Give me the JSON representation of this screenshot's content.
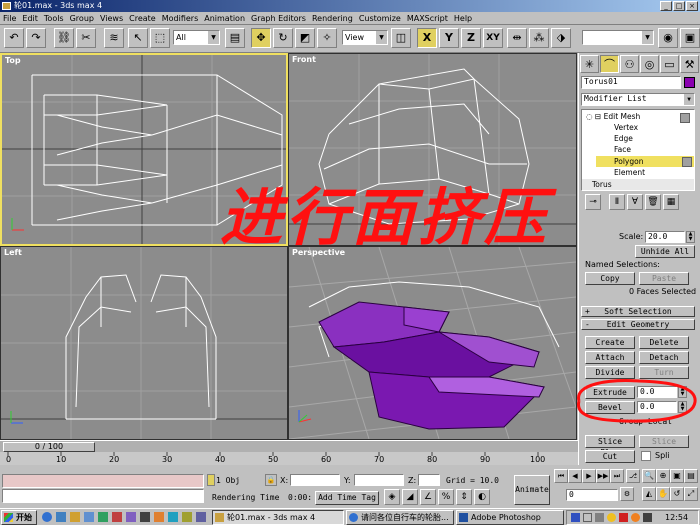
{
  "window": {
    "title": "轮01.max - 3ds max 4"
  },
  "menu": [
    "File",
    "Edit",
    "Tools",
    "Group",
    "Views",
    "Create",
    "Modifiers",
    "Animation",
    "Graph Editors",
    "Rendering",
    "Customize",
    "MAXScript",
    "Help"
  ],
  "toolbar": {
    "selection_filter": "All",
    "ref_coord": "View",
    "axis_x": "X",
    "axis_y": "Y",
    "axis_z": "Z",
    "axis_xy": "XY"
  },
  "viewports": {
    "top": "Top",
    "front": "Front",
    "left": "Left",
    "perspective": "Perspective"
  },
  "annotation": "进行面挤压",
  "colors": {
    "selection": "#7a1aa0",
    "highlight": "#f0e060",
    "annotation": "#ff1010",
    "object_swatch": "#8a00b0"
  },
  "command_panel": {
    "object_name": "Torus01",
    "modifier_list": "Modifier List",
    "stack": {
      "edit_mesh": "Edit Mesh",
      "vertex": "Vertex",
      "edge": "Edge",
      "face": "Face",
      "polygon": "Polygon",
      "element": "Element",
      "torus": "Torus"
    },
    "scale_label": "Scale:",
    "scale_value": "20.0",
    "unhide_all": "Unhide All",
    "named_selections": "Named Selections:",
    "copy": "Copy",
    "paste": "Paste",
    "faces_selected": "0 Faces Selected",
    "soft_selection": "Soft Selection",
    "edit_geometry": "Edit Geometry",
    "create": "Create",
    "delete": "Delete",
    "attach": "Attach",
    "detach": "Detach",
    "divide": "Divide",
    "turn": "Turn",
    "extrude": "Extrude",
    "extrude_value": "0.0",
    "bevel": "Bevel",
    "bevel_value": "0.0",
    "group_local": "Group  Local",
    "slice_plane": "Slice Plan",
    "slice": "Slice",
    "cut": "Cut",
    "split": "Spli"
  },
  "timeline": {
    "slider": "0 / 100",
    "ticks": [
      "0",
      "10",
      "20",
      "30",
      "40",
      "50",
      "60",
      "70",
      "80",
      "90",
      "100"
    ]
  },
  "status": {
    "objects": "1 Obj",
    "x_label": "X:",
    "y_label": "Y:",
    "z_label": "Z:",
    "grid": "Grid = 10.0",
    "rendering_time": "Rendering Time",
    "time_value": "0:00:",
    "add_time_tag": "Add Time Tag",
    "animate": "Animate",
    "frame": "0"
  },
  "taskbar": {
    "start": "开始",
    "tasks": [
      "轮01.max - 3ds max 4",
      "请问各位自行车的轮胎...",
      "Adobe Photoshop"
    ],
    "clock": "12:54"
  }
}
